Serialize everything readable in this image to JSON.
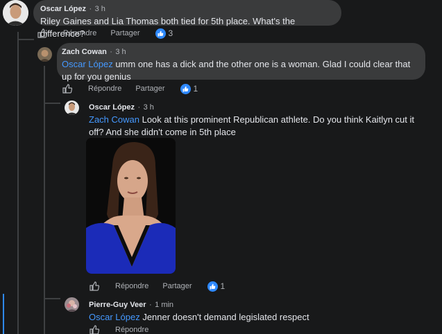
{
  "comments": [
    {
      "author": "Oscar López",
      "time": "3 h",
      "mention": "",
      "text": "Riley Gaines and Lia Thomas both tied for 5th place. What's the difference?",
      "reply_label": "Répondre",
      "share_label": "Partager",
      "reaction_count": "3"
    },
    {
      "author": "Zach Cowan",
      "time": "3 h",
      "mention": "Oscar López",
      "text_line1": " umm one has a dick and the other one is a woman. Glad I could clear that",
      "text_line2": "up for you genius",
      "reply_label": "Répondre",
      "share_label": "Partager",
      "reaction_count": "1"
    },
    {
      "author": "Oscar López",
      "time": "3 h",
      "mention": "Zach Cowan",
      "text_line1": " Look at this prominent Republican athlete. Do you think Kaitlyn cut it",
      "text_line2": "off? And she didn't come in 5th place",
      "reply_label": "Répondre",
      "share_label": "Partager",
      "reaction_count": "1"
    },
    {
      "author": "Pierre-Guy Veer",
      "time": "1 min",
      "mention": "Oscar López",
      "text": " Jenner doesn't demand legislated respect",
      "reply_label": "Répondre"
    }
  ],
  "separator": "·",
  "colors": {
    "background": "#18191a",
    "bubble": "#3a3b3c",
    "mention": "#4599ff",
    "reaction_blue": "#2e89ff",
    "muted": "#b0b3b8"
  }
}
